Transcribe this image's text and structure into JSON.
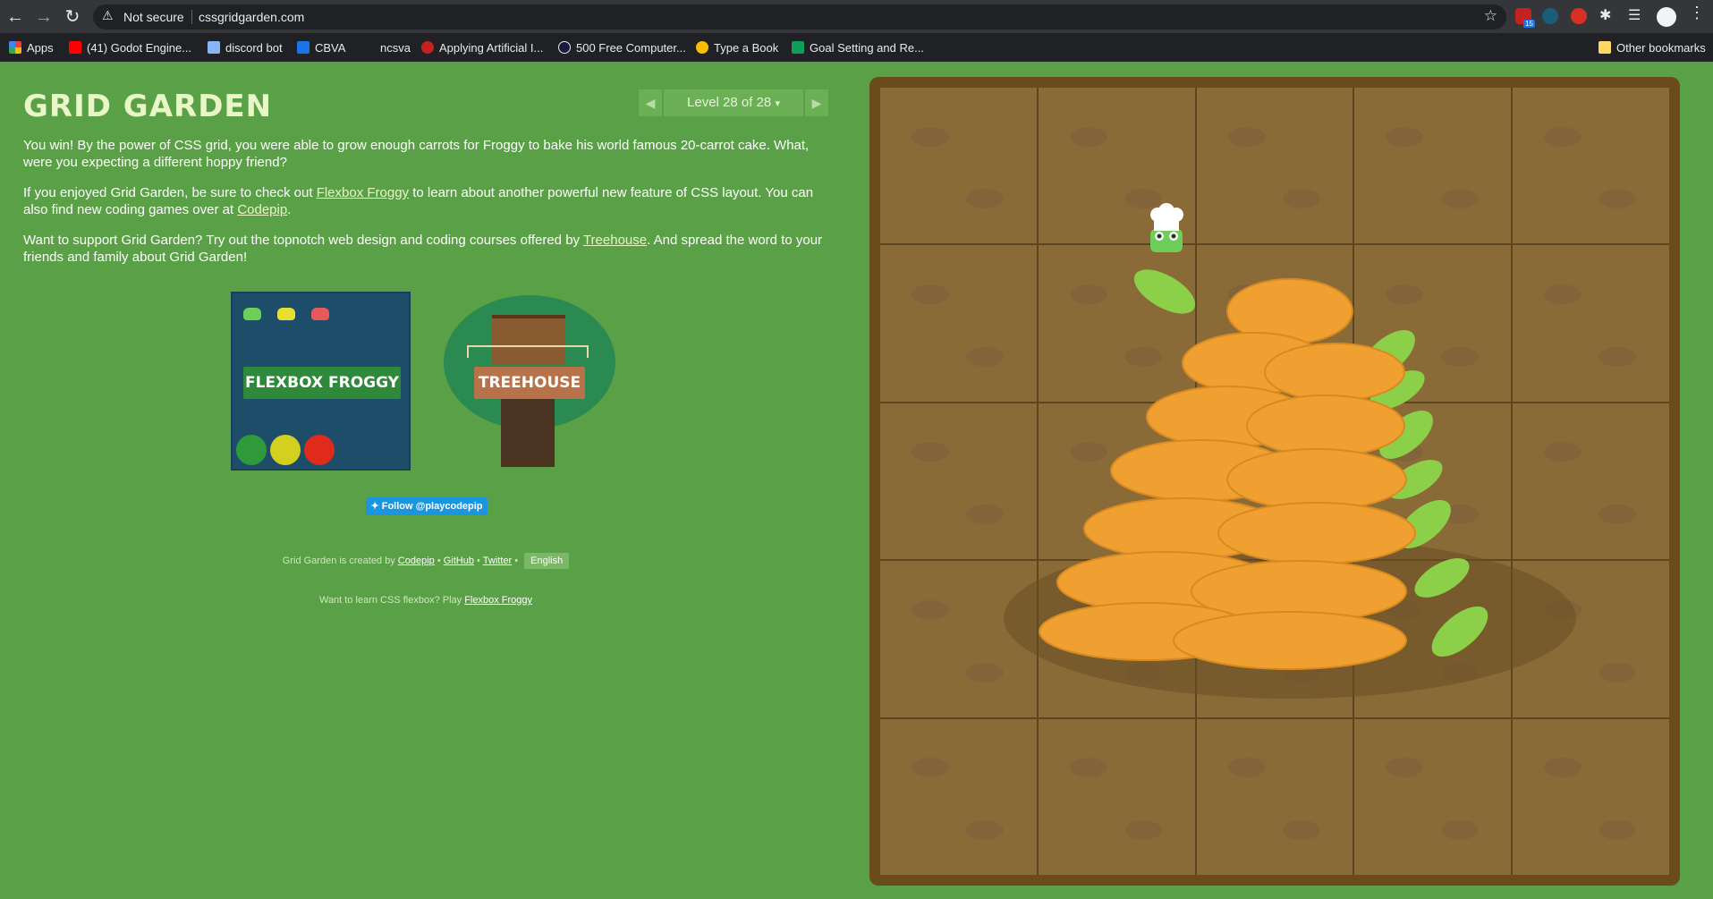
{
  "browser": {
    "not_secure_label": "Not secure",
    "url": "cssgridgarden.com",
    "badge_count": "15",
    "bookmarks": [
      {
        "label": "Apps",
        "color": "#ea4335"
      },
      {
        "label": "(41) Godot Engine...",
        "color": "#ff0000"
      },
      {
        "label": "discord bot",
        "color": "#8ab4f8"
      },
      {
        "label": "CBVA",
        "color": "#1a73e8"
      },
      {
        "label": "ncsva",
        "color": "#202124"
      },
      {
        "label": "Applying Artificial I...",
        "color": "#c5221f"
      },
      {
        "label": "500 Free Computer...",
        "color": "#1a1a3a"
      },
      {
        "label": "Type a Book",
        "color": "#fbbc04"
      },
      {
        "label": "Goal Setting and Re...",
        "color": "#0f9d58"
      }
    ],
    "other_bookmarks": "Other bookmarks"
  },
  "page": {
    "logo": "GRID GARDEN",
    "level_label": "Level 28 of 28",
    "level_dropdown_glyph": "▾",
    "prev_glyph": "◀",
    "next_glyph": "▶",
    "para1": "You win! By the power of CSS grid, you were able to grow enough carrots for Froggy to bake his world famous 20-carrot cake. What, were you expecting a different hoppy friend?",
    "para2_before": "If you enjoyed Grid Garden, be sure to check out ",
    "para2_link1": "Flexbox Froggy",
    "para2_middle": " to learn about another powerful new feature of CSS layout. You can also find new coding games over at ",
    "para2_link2": "Codepip",
    "para2_after": ".",
    "para3_before": "Want to support Grid Garden? Try out the topnotch web design and coding courses offered by ",
    "para3_link": "Treehouse",
    "para3_after": ". And spread the word to your friends and family about Grid Garden!",
    "flexbox_sign": "FLEXBOX FROGGY",
    "treehouse_sign": "TREEHOUSE",
    "follow_label": "Follow @playcodepip",
    "credits_prefix": "Grid Garden is created by ",
    "credits_codepip": "Codepip",
    "credits_sep": " • ",
    "credits_github": "GitHub",
    "credits_twitter": "Twitter",
    "language": "English",
    "learn_prefix": "Want to learn CSS flexbox? Play ",
    "learn_link": "Flexbox Froggy"
  },
  "colors": {
    "page_bg": "#5aa046",
    "garden_soil": "#8a6b38",
    "carrot": "#f0a030",
    "leaf": "#8cd04a"
  },
  "icons": {
    "back": "arrow-left-icon",
    "forward": "arrow-right-icon",
    "reload": "reload-icon",
    "warning": "warning-icon",
    "star": "star-icon",
    "twitter": "twitter-bird-icon"
  }
}
